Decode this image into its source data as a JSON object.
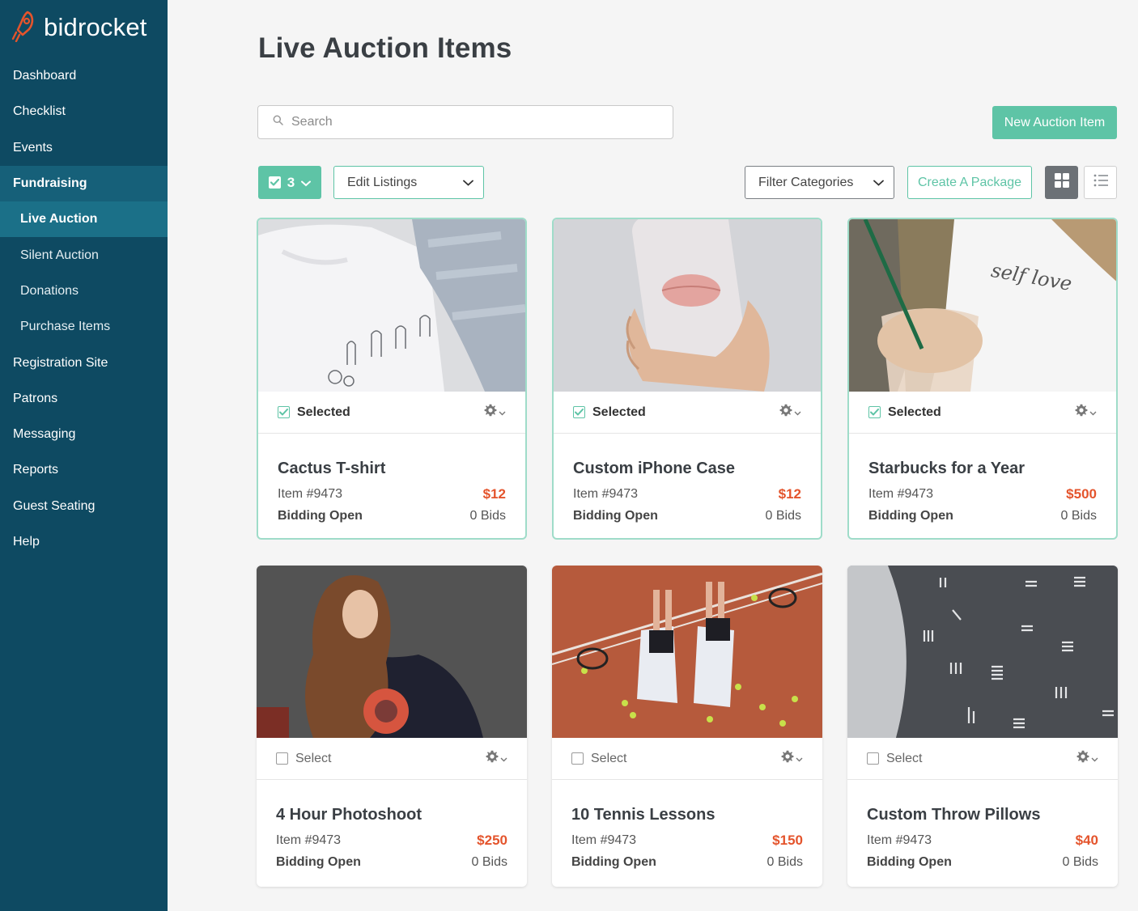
{
  "brand": {
    "name": "bidrocket",
    "accent": "#5ec4a6",
    "sidebar_bg": "#0e4a62",
    "price_color": "#e4542c"
  },
  "sidebar": {
    "items": [
      {
        "label": "Dashboard",
        "kind": "top"
      },
      {
        "label": "Checklist",
        "kind": "top"
      },
      {
        "label": "Events",
        "kind": "top"
      },
      {
        "label": "Fundraising",
        "kind": "section"
      },
      {
        "label": "Live Auction",
        "kind": "sub-active"
      },
      {
        "label": "Silent Auction",
        "kind": "sub"
      },
      {
        "label": "Donations",
        "kind": "sub"
      },
      {
        "label": "Purchase Items",
        "kind": "sub"
      },
      {
        "label": "Registration Site",
        "kind": "top"
      },
      {
        "label": "Patrons",
        "kind": "top"
      },
      {
        "label": "Messaging",
        "kind": "top"
      },
      {
        "label": "Reports",
        "kind": "top"
      },
      {
        "label": "Guest Seating",
        "kind": "top"
      },
      {
        "label": "Help",
        "kind": "top"
      }
    ]
  },
  "header": {
    "title": "Live Auction Items"
  },
  "search": {
    "placeholder": "Search",
    "value": ""
  },
  "toolbar": {
    "new_item_label": "New Auction Item",
    "selected_count": "3",
    "edit_listings_label": "Edit Listings",
    "filter_categories_label": "Filter Categories",
    "create_package_label": "Create A Package",
    "view_mode": "grid"
  },
  "cards": [
    {
      "title": "Cactus T-shirt",
      "item_no": "Item #9473",
      "price": "$12",
      "status": "Bidding Open",
      "bids": "0 Bids",
      "selected": true,
      "select_label": "Selected",
      "image": "cactus-tshirt-photo"
    },
    {
      "title": "Custom iPhone Case",
      "item_no": "Item #9473",
      "price": "$12",
      "status": "Bidding Open",
      "bids": "0 Bids",
      "selected": true,
      "select_label": "Selected",
      "image": "phone-case-photo"
    },
    {
      "title": "Starbucks for a Year",
      "item_no": "Item #9473",
      "price": "$500",
      "status": "Bidding Open",
      "bids": "0 Bids",
      "selected": true,
      "select_label": "Selected",
      "image": "starbucks-photo"
    },
    {
      "title": "4 Hour Photoshoot",
      "item_no": "Item #9473",
      "price": "$250",
      "status": "Bidding Open",
      "bids": "0 Bids",
      "selected": false,
      "select_label": "Select",
      "image": "photoshoot-photo"
    },
    {
      "title": "10 Tennis Lessons",
      "item_no": "Item #9473",
      "price": "$150",
      "status": "Bidding Open",
      "bids": "0 Bids",
      "selected": false,
      "select_label": "Select",
      "image": "tennis-photo"
    },
    {
      "title": "Custom Throw Pillows",
      "item_no": "Item #9473",
      "price": "$40",
      "status": "Bidding Open",
      "bids": "0 Bids",
      "selected": false,
      "select_label": "Select",
      "image": "pillow-photo"
    }
  ]
}
